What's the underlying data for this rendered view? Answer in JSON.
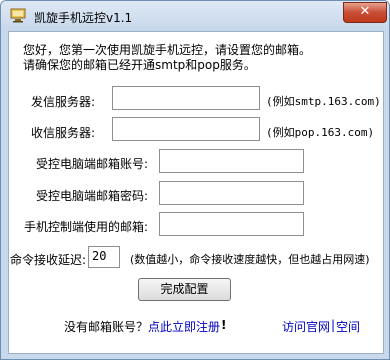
{
  "window": {
    "title": "凯旋手机远控v1.1",
    "close_symbol": "✕"
  },
  "intro": {
    "line1": "您好，您第一次使用凯旋手机远控，请设置您的邮箱。",
    "line2": "请确保您的邮箱已经开通smtp和pop服务。"
  },
  "form": {
    "smtp_label": "发信服务器:",
    "smtp_value": "",
    "smtp_hint": "(例如smtp.163.com)",
    "pop_label": "收信服务器:",
    "pop_value": "",
    "pop_hint": "(例如pop.163.com)",
    "account_label": "受控电脑端邮箱账号:",
    "account_value": "",
    "password_label": "受控电脑端邮箱密码:",
    "password_value": "",
    "phone_email_label": "手机控制端使用的邮箱:",
    "phone_email_value": "",
    "delay_label": "命令接收延迟:",
    "delay_value": "20",
    "delay_hint": "(数值越小，命令接收速度越快，但也越占用网速)"
  },
  "buttons": {
    "finish_label": "完成配置"
  },
  "footer": {
    "no_account_text": "没有邮箱账号？",
    "register_link": "点此立即注册",
    "register_suffix": "!",
    "visit_site_link": "访问官网",
    "separator": "|",
    "space_link": "空间"
  },
  "icons": {
    "app": "app-window-icon",
    "close": "close-icon"
  },
  "colors": {
    "close_button": "#c74e35",
    "link": "#0000c0",
    "frame": "#c9d9ec"
  }
}
